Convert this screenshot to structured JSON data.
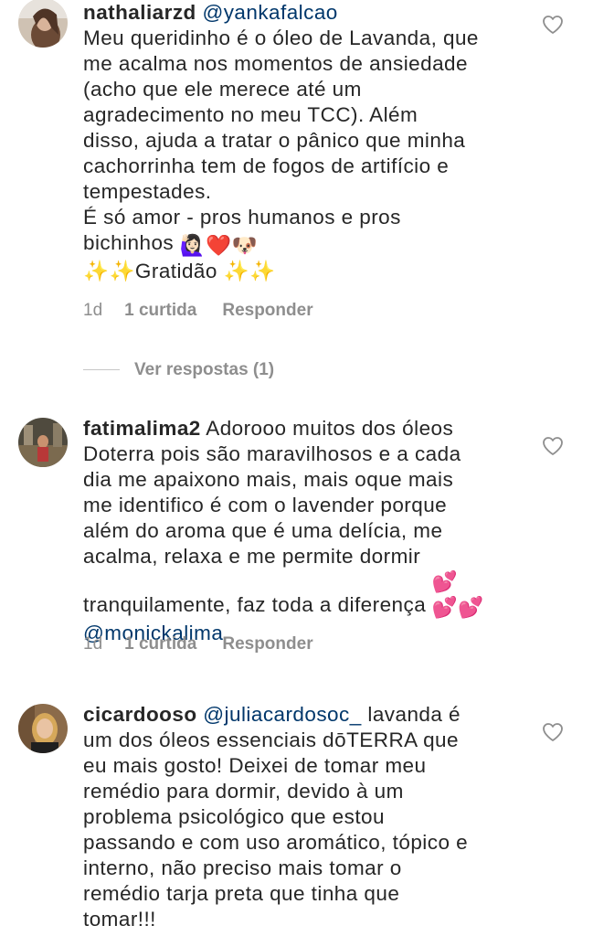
{
  "comments": [
    {
      "username": "nathaliarzd",
      "mention": "@yankafalcao",
      "body_before": "",
      "body": "Meu queridinho é o óleo de Lavanda, que\nme acalma nos momentos de ansiedade\n(acho que ele merece até um\nagradecimento no meu TCC). Além\ndisso, ajuda a tratar o pânico que minha\ncachorrinha tem de fogos de artifício e\ntempestades.\nÉ só amor - pros humanos e pros\nbichinhos",
      "body_emojis": "🙋🏻‍♀️❤️🐶",
      "extra_line": "✨✨Gratidão ✨✨",
      "time": "1d",
      "likes": "1 curtida",
      "reply_label": "Responder",
      "view_replies": "Ver respostas (1)"
    },
    {
      "username": "fatimalima2",
      "body": "Adorooo muitos dos óleos\nDoterra pois são maravilhosos e a cada\ndia me apaixono mais, mais oque mais\nme identifico é com o lavender porque\nalém do aroma que é uma delícia, me\nacalma, relaxa e me permite dormir\ntranquilamente, faz toda a diferença",
      "body_emojis": "💕\n💕💕",
      "mention": "@monickalima",
      "time": "1d",
      "likes": "1 curtida",
      "reply_label": "Responder"
    },
    {
      "username": "cicardooso",
      "mention": "@juliacardosoc_",
      "body": "lavanda é\num dos óleos essenciais dōTERRA que\neu mais gosto! Deixei de tomar meu\nremédio para dormir, devido à um\nproblema psicológico que estou\npassando e com uso aromático, tópico e\ninterno, não preciso mais tomar o\nremédio tarja preta que tinha que\ntomar!!!"
    }
  ],
  "colors": {
    "text": "#262626",
    "meta": "#8e8e8e",
    "mention": "#00376b"
  },
  "icons": {
    "like": "heart-outline-icon"
  }
}
